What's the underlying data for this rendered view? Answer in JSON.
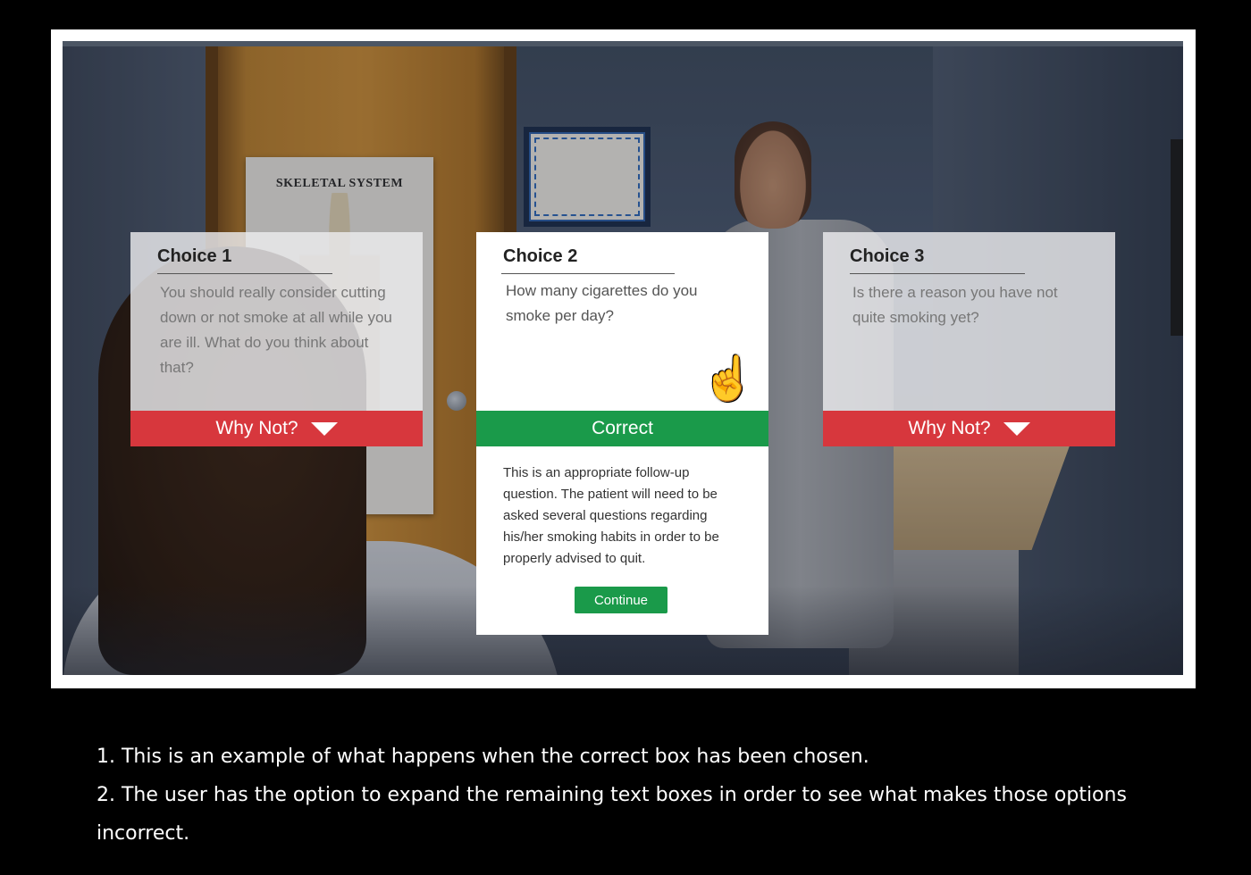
{
  "scene": {
    "poster_title": "SKELETAL SYSTEM"
  },
  "choices": [
    {
      "title": "Choice 1",
      "text": "You should really consider cutting down or not smoke at all while you are ill.  What do you think about that?",
      "bar_label": "Why Not?",
      "state": "incorrect"
    },
    {
      "title": "Choice 2",
      "text": "How many cigarettes do you smoke per day?",
      "bar_label": "Correct",
      "state": "correct",
      "feedback": "This is an appropriate follow-up question.  The patient will need to be asked several questions regarding his/her smoking habits in order to be properly advised to quit.",
      "continue_label": "Continue"
    },
    {
      "title": "Choice 3",
      "text": "Is there a reason you have not quite smoking yet?",
      "bar_label": "Why Not?",
      "state": "incorrect"
    }
  ],
  "colors": {
    "incorrect_bar": "#d7373d",
    "correct_bar": "#1a9a4a"
  },
  "caption": {
    "line1": "1. This is an example of what happens when the correct box has been chosen.",
    "line2": "2. The user has the option to expand the remaining text boxes in order to see what makes those options incorrect."
  }
}
